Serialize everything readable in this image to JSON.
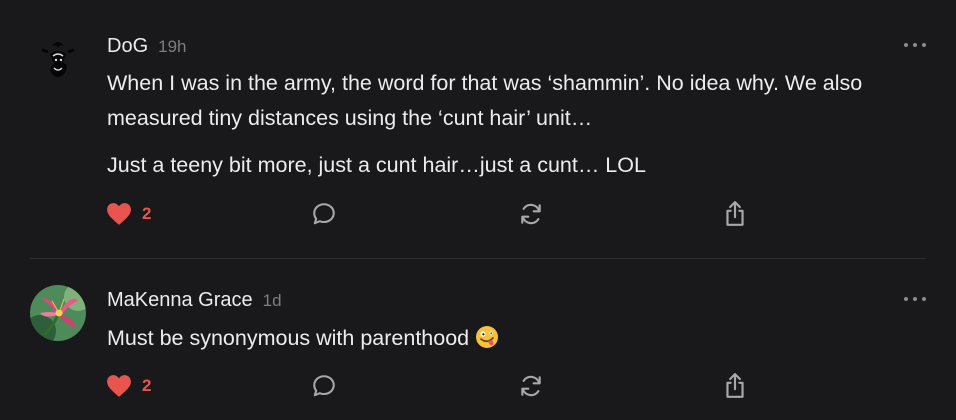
{
  "comments": [
    {
      "author": "DoG",
      "time": "19h",
      "paragraphs": [
        "When I was in the army, the word for that was ‘shammin’. No idea why. We also measured tiny distances using the ‘cunt hair’ unit…",
        "Just a teeny bit more, just a cunt hair…just a cunt… LOL"
      ],
      "like_count": "2",
      "liked": true
    },
    {
      "author": "MaKenna Grace",
      "time": "1d",
      "text": "Must be synonymous with parenthood",
      "emoji": "zany-face",
      "like_count": "2",
      "liked": true
    }
  ],
  "colors": {
    "background": "#19191b",
    "text": "#ececec",
    "muted": "#7d7d80",
    "like": "#e8554e",
    "icon": "#a8a8ab"
  },
  "icons": [
    "heart-icon",
    "comment-icon",
    "restack-icon",
    "share-icon",
    "more-icon"
  ]
}
